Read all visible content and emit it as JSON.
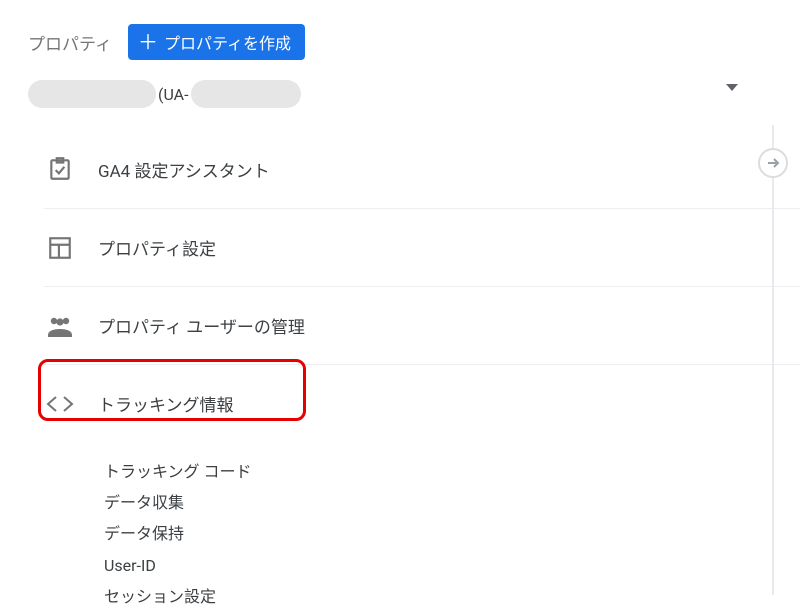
{
  "header": {
    "section_label": "プロパティ",
    "create_button": "プロパティを作成"
  },
  "selector": {
    "ua_fragment": "(UA-"
  },
  "menu": {
    "items": [
      {
        "label": "GA4 設定アシスタント"
      },
      {
        "label": "プロパティ設定"
      },
      {
        "label": "プロパティ ユーザーの管理"
      },
      {
        "label": "トラッキング情報"
      }
    ]
  },
  "submenu": {
    "items": [
      "トラッキング コード",
      "データ収集",
      "データ保持",
      "User-ID",
      "セッション設定"
    ]
  }
}
